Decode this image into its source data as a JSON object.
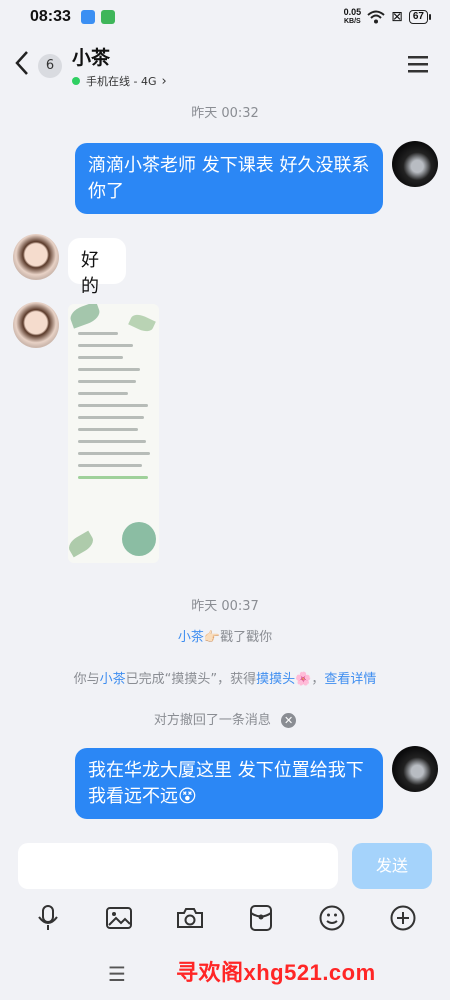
{
  "status_bar": {
    "time": "08:33",
    "net_speed_value": "0.05",
    "net_speed_unit": "KB/S",
    "battery": "67"
  },
  "header": {
    "unread_count": "6",
    "contact_name": "小茶",
    "online_status": "手机在线 - 4G",
    "chevron": "›"
  },
  "timestamps": {
    "first": "昨天 00:32",
    "second": "昨天 00:37"
  },
  "messages": [
    {
      "from": "self",
      "text": "滴滴小茶老师 发下课表 好久没联系你了"
    },
    {
      "from": "other",
      "text": "好的"
    },
    {
      "from": "other",
      "type": "image"
    },
    {
      "from": "self",
      "text": "我在华龙大厦这里 发下位置给我下 我看远不远"
    }
  ],
  "system": {
    "poke_name": "小茶",
    "poke_text": "戳了戳你",
    "achievement_prefix": "你与",
    "achievement_name": "小茶",
    "achievement_middle": "已完成“摸摸头”，获得",
    "achievement_badge": "摸摸头",
    "achievement_link": "查看详情",
    "recall_text": "对方撤回了一条消息"
  },
  "input": {
    "placeholder": "",
    "send_label": "发送"
  },
  "watermark": "寻欢阁xhg521.com",
  "colors": {
    "accent": "#2b87f5",
    "online": "#2fcf62",
    "send_disabled": "#a5d3fb",
    "watermark": "#ff2626"
  },
  "icons": [
    "voice-icon",
    "image-icon",
    "camera-icon",
    "red-packet-icon",
    "emoji-icon",
    "plus-icon"
  ]
}
